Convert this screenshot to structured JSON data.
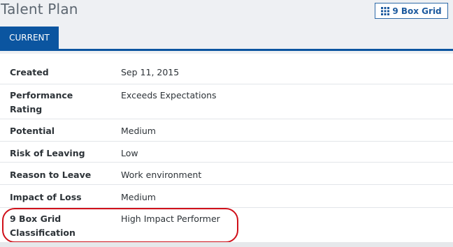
{
  "header": {
    "title": "Talent Plan",
    "nine_box_button": {
      "label": "9 Box Grid",
      "icon": "grid-icon"
    }
  },
  "tabs": [
    {
      "label": "CURRENT",
      "active": true
    }
  ],
  "details": [
    {
      "label": "Created",
      "value": "Sep 11, 2015"
    },
    {
      "label": "Performance Rating",
      "value": "Exceeds Expectations"
    },
    {
      "label": "Potential",
      "value": "Medium"
    },
    {
      "label": "Risk of Leaving",
      "value": "Low"
    },
    {
      "label": "Reason to Leave",
      "value": "Work environment"
    },
    {
      "label": "Impact of Loss",
      "value": "Medium"
    },
    {
      "label": "9 Box Grid Classification",
      "value": "High Impact Performer"
    }
  ],
  "colors": {
    "accent": "#0b55a0",
    "highlight": "#d0101a"
  }
}
